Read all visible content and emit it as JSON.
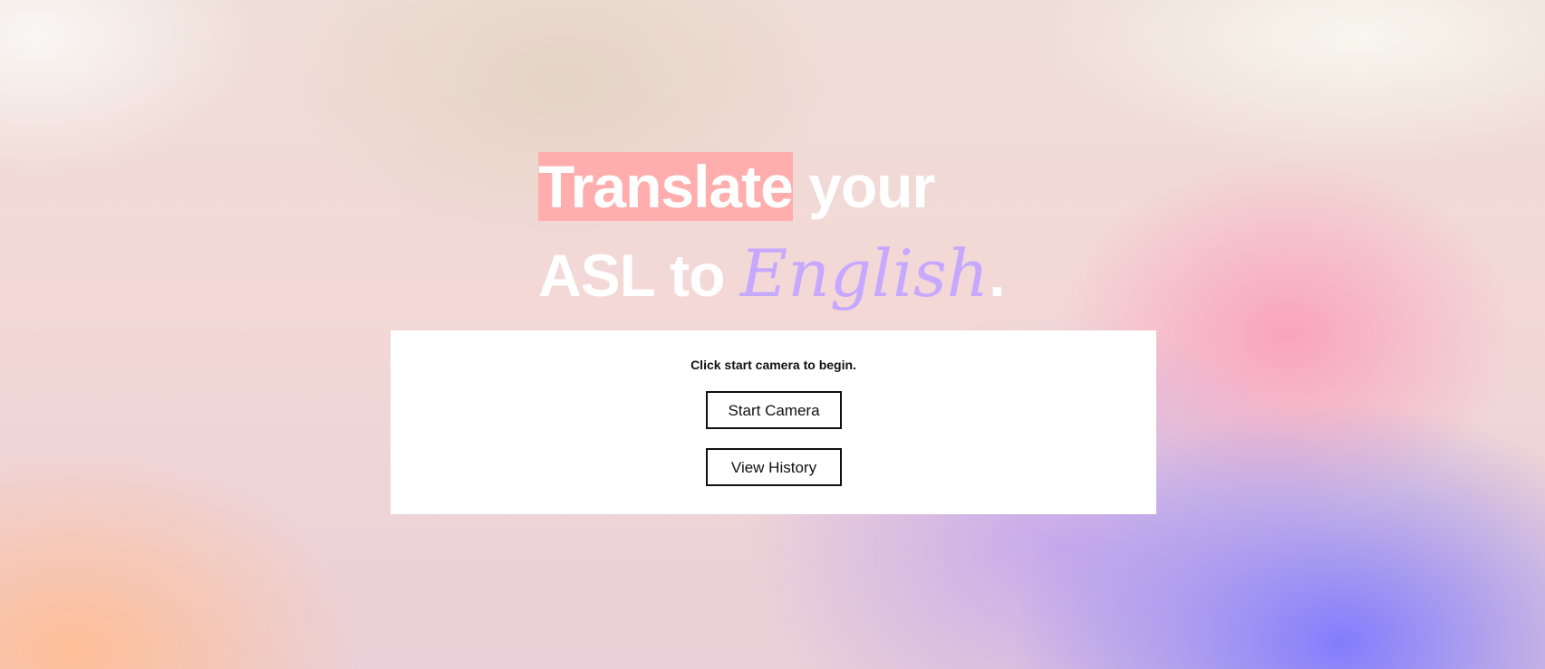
{
  "hero": {
    "highlight_word": "Translate",
    "line1_rest": " your",
    "line2_prefix": "ASL to ",
    "script_word": "English",
    "line2_suffix": "."
  },
  "card": {
    "prompt_before": "Click ",
    "prompt_bold": "start camera",
    "prompt_after": " to begin.",
    "start_camera_label": "Start Camera",
    "view_history_label": "View History"
  },
  "colors": {
    "highlight_bg": "#ffadad",
    "script_text": "#c7a8ff",
    "headline_text": "#ffffff",
    "card_bg": "#ffffff",
    "button_border": "#111111"
  }
}
